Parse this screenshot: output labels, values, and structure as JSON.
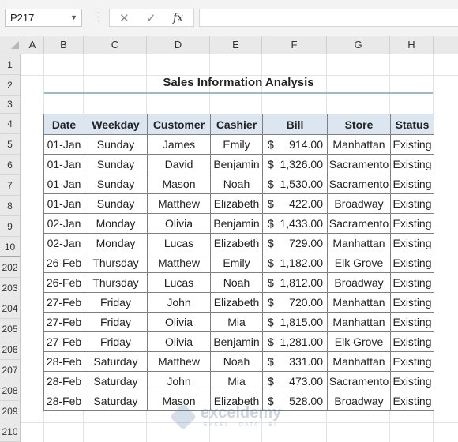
{
  "formula_bar": {
    "name_box": "P217",
    "fx_label": "fx",
    "formula": ""
  },
  "columns": [
    "A",
    "B",
    "C",
    "D",
    "E",
    "F",
    "G",
    "H"
  ],
  "rows": [
    "1",
    "2",
    "3",
    "4",
    "5",
    "6",
    "7",
    "8",
    "9",
    "10",
    "202",
    "203",
    "204",
    "205",
    "206",
    "207",
    "208",
    "209",
    "210"
  ],
  "sheet": {
    "title": "Sales Information Analysis",
    "headers": [
      "Date",
      "Weekday",
      "Customer",
      "Cashier",
      "Bill",
      "Store",
      "Status"
    ],
    "currency_symbol": "$",
    "records": [
      {
        "date": "01-Jan",
        "weekday": "Sunday",
        "customer": "James",
        "cashier": "Emily",
        "bill": "914.00",
        "store": "Manhattan",
        "status": "Existing"
      },
      {
        "date": "01-Jan",
        "weekday": "Sunday",
        "customer": "David",
        "cashier": "Benjamin",
        "bill": "1,326.00",
        "store": "Sacramento",
        "status": "Existing"
      },
      {
        "date": "01-Jan",
        "weekday": "Sunday",
        "customer": "Mason",
        "cashier": "Noah",
        "bill": "1,530.00",
        "store": "Sacramento",
        "status": "Existing"
      },
      {
        "date": "01-Jan",
        "weekday": "Sunday",
        "customer": "Matthew",
        "cashier": "Elizabeth",
        "bill": "422.00",
        "store": "Broadway",
        "status": "Existing"
      },
      {
        "date": "02-Jan",
        "weekday": "Monday",
        "customer": "Olivia",
        "cashier": "Benjamin",
        "bill": "1,433.00",
        "store": "Sacramento",
        "status": "Existing"
      },
      {
        "date": "02-Jan",
        "weekday": "Monday",
        "customer": "Lucas",
        "cashier": "Elizabeth",
        "bill": "729.00",
        "store": "Manhattan",
        "status": "Existing"
      },
      {
        "date": "26-Feb",
        "weekday": "Thursday",
        "customer": "Matthew",
        "cashier": "Emily",
        "bill": "1,182.00",
        "store": "Elk Grove",
        "status": "Existing"
      },
      {
        "date": "26-Feb",
        "weekday": "Thursday",
        "customer": "Lucas",
        "cashier": "Noah",
        "bill": "1,812.00",
        "store": "Broadway",
        "status": "Existing"
      },
      {
        "date": "27-Feb",
        "weekday": "Friday",
        "customer": "John",
        "cashier": "Elizabeth",
        "bill": "720.00",
        "store": "Manhattan",
        "status": "Existing"
      },
      {
        "date": "27-Feb",
        "weekday": "Friday",
        "customer": "Olivia",
        "cashier": "Mia",
        "bill": "1,815.00",
        "store": "Manhattan",
        "status": "Existing"
      },
      {
        "date": "27-Feb",
        "weekday": "Friday",
        "customer": "Olivia",
        "cashier": "Benjamin",
        "bill": "1,281.00",
        "store": "Elk Grove",
        "status": "Existing"
      },
      {
        "date": "28-Feb",
        "weekday": "Saturday",
        "customer": "Matthew",
        "cashier": "Noah",
        "bill": "331.00",
        "store": "Manhattan",
        "status": "Existing"
      },
      {
        "date": "28-Feb",
        "weekday": "Saturday",
        "customer": "John",
        "cashier": "Mia",
        "bill": "473.00",
        "store": "Sacramento",
        "status": "Existing"
      },
      {
        "date": "28-Feb",
        "weekday": "Saturday",
        "customer": "Mason",
        "cashier": "Elizabeth",
        "bill": "528.00",
        "store": "Broadway",
        "status": "Existing"
      }
    ]
  },
  "watermark": {
    "name": "exceldemy",
    "tagline": "EXCEL · DATA · BI"
  }
}
